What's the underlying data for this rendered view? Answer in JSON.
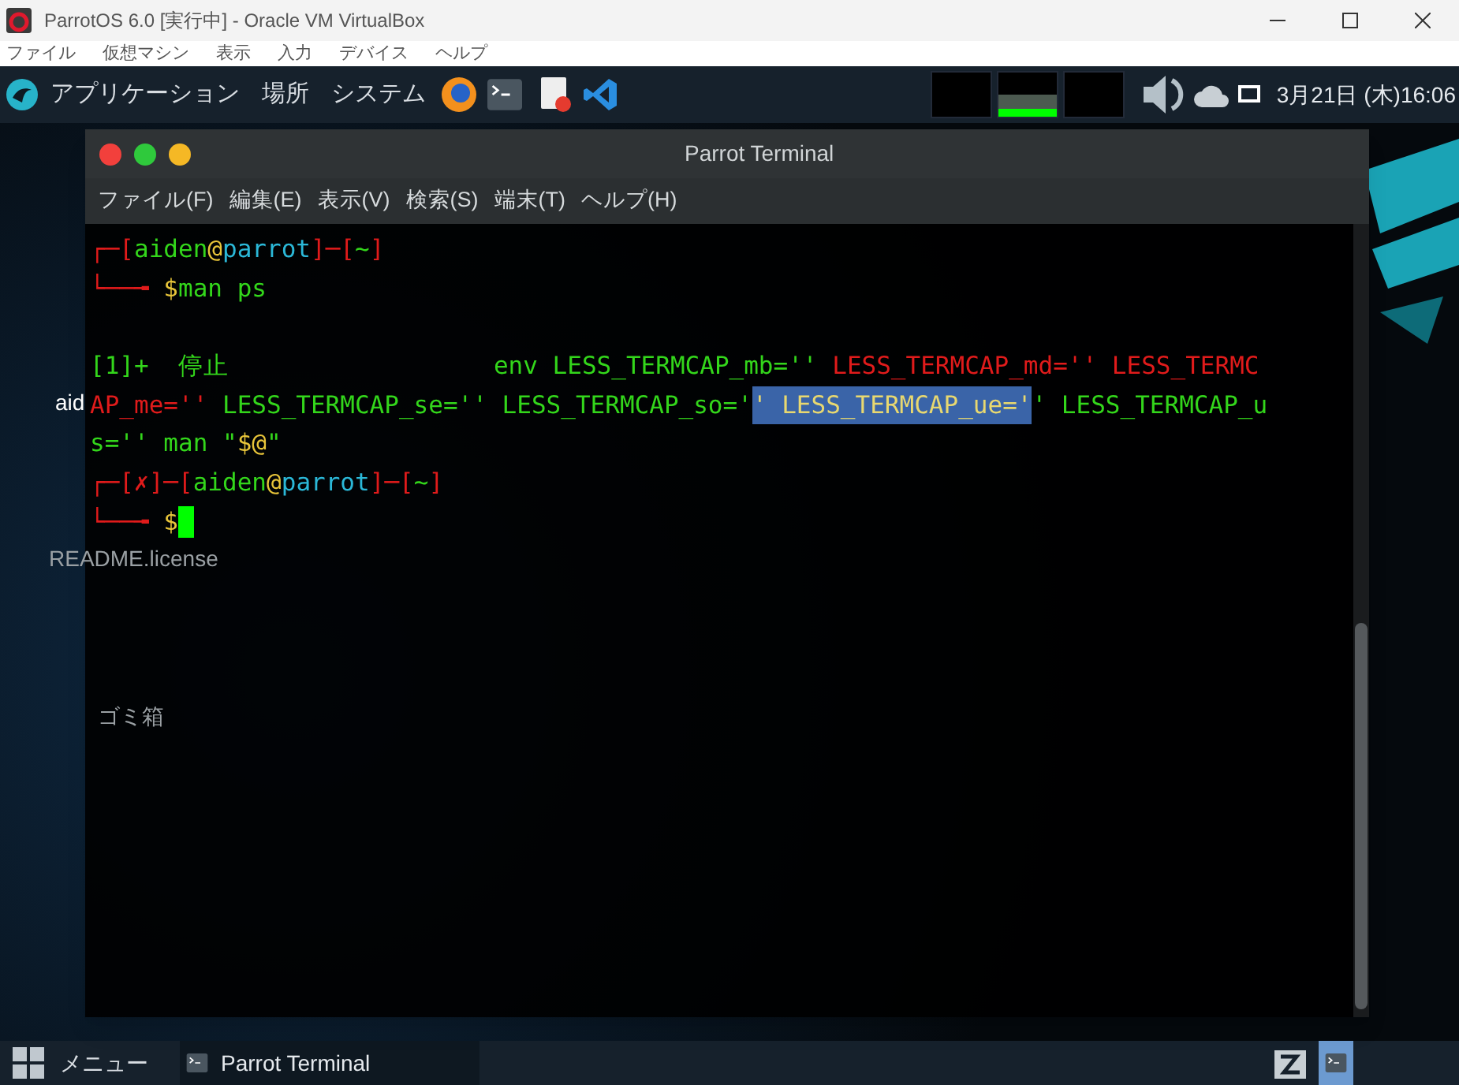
{
  "vbox": {
    "title": "ParrotOS 6.0 [実行中] - Oracle VM VirtualBox",
    "menu": [
      "ファイル",
      "仮想マシン",
      "表示",
      "入力",
      "デバイス",
      "ヘルプ"
    ]
  },
  "top_panel": {
    "menus": [
      "アプリケーション",
      "場所",
      "システム"
    ],
    "clock": "3月21日 (木)16:06"
  },
  "desktop_icons": [
    {
      "label": "aid"
    },
    {
      "label": "README.license"
    },
    {
      "label": "ゴミ箱"
    }
  ],
  "terminal": {
    "title": "Parrot Terminal",
    "menu": [
      "ファイル(F)",
      "編集(E)",
      "表示(V)",
      "検索(S)",
      "端末(T)",
      "ヘルプ(H)"
    ],
    "lines": [
      {
        "kind": "text",
        "segments": [
          {
            "text": "┌─[",
            "color": "#e01b1b"
          },
          {
            "text": "aiden",
            "color": "#33d61b"
          },
          {
            "text": "@",
            "color": "#e8c53a"
          },
          {
            "text": "parrot",
            "color": "#2bb8d8"
          },
          {
            "text": "]─[",
            "color": "#e01b1b"
          },
          {
            "text": "~",
            "color": "#33d61b"
          },
          {
            "text": "]",
            "color": "#e01b1b"
          }
        ]
      },
      {
        "kind": "text",
        "segments": [
          {
            "text": "└──╼ ",
            "color": "#e01b1b"
          },
          {
            "text": "$",
            "color": "#e8c53a"
          },
          {
            "text": "man ps",
            "color": "#33d61b"
          }
        ]
      },
      {
        "kind": "blank"
      },
      {
        "kind": "text",
        "segments": [
          {
            "text": "[1]+  停止                  env LESS_TERMCAP_mb='' ",
            "color": "#33d61b"
          },
          {
            "text": "LESS_TERMCAP_md='' LESS_TERMC",
            "color": "#e01b1b"
          }
        ]
      },
      {
        "kind": "text",
        "segments": [
          {
            "text": "AP_me=''",
            "color": "#e01b1b"
          },
          {
            "text": " LESS_TERMCAP_se='' LESS_TERMCAP_so='",
            "color": "#33d61b"
          },
          {
            "text": "' LESS_TERMCAP_ue='",
            "highlighted": true
          },
          {
            "text": "' LESS_TERMCAP_u",
            "color": "#33d61b"
          }
        ]
      },
      {
        "kind": "text",
        "segments": [
          {
            "text": "s='' man \"",
            "color": "#33d61b"
          },
          {
            "text": "$@",
            "color": "#e8c53a"
          },
          {
            "text": "\"",
            "color": "#33d61b"
          }
        ]
      },
      {
        "kind": "text",
        "segments": [
          {
            "text": "┌─[",
            "color": "#e01b1b"
          },
          {
            "text": "✗",
            "color": "#e01b1b"
          },
          {
            "text": "]─[",
            "color": "#e01b1b"
          },
          {
            "text": "aiden",
            "color": "#33d61b"
          },
          {
            "text": "@",
            "color": "#e8c53a"
          },
          {
            "text": "parrot",
            "color": "#2bb8d8"
          },
          {
            "text": "]─[",
            "color": "#e01b1b"
          },
          {
            "text": "~",
            "color": "#33d61b"
          },
          {
            "text": "]",
            "color": "#e01b1b"
          }
        ]
      },
      {
        "kind": "prompt",
        "segments": [
          {
            "text": "└──╼ ",
            "color": "#e01b1b"
          },
          {
            "text": "$",
            "color": "#e8c53a"
          }
        ]
      }
    ]
  },
  "bottom_panel": {
    "menu": "メニュー",
    "tasks": [
      {
        "label": "Parrot Terminal",
        "selected": false
      }
    ]
  }
}
